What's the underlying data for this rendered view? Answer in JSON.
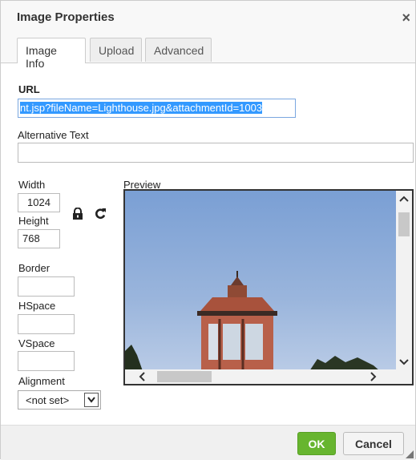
{
  "dialog": {
    "title": "Image Properties",
    "close_glyph": "×"
  },
  "tabs": [
    {
      "label": "Image Info"
    },
    {
      "label": "Upload"
    },
    {
      "label": "Advanced"
    }
  ],
  "info": {
    "url_label": "URL",
    "url_value": "nt.jsp?fileName=Lighthouse.jpg&attachmentId=1003",
    "alt_label": "Alternative Text",
    "alt_value": "",
    "width_label": "Width",
    "width_value": "1024",
    "height_label": "Height",
    "height_value": "768",
    "preview_label": "Preview",
    "border_label": "Border",
    "hspace_label": "HSpace",
    "vspace_label": "VSpace",
    "alignment_label": "Alignment",
    "alignment_value": "<not set>"
  },
  "icons": {
    "lock": "lock-icon",
    "reset": "reset-size-icon"
  },
  "buttons": {
    "ok": "OK",
    "cancel": "Cancel"
  },
  "colors": {
    "ok_green": "#67b52f",
    "selection_blue": "#3399ff"
  }
}
